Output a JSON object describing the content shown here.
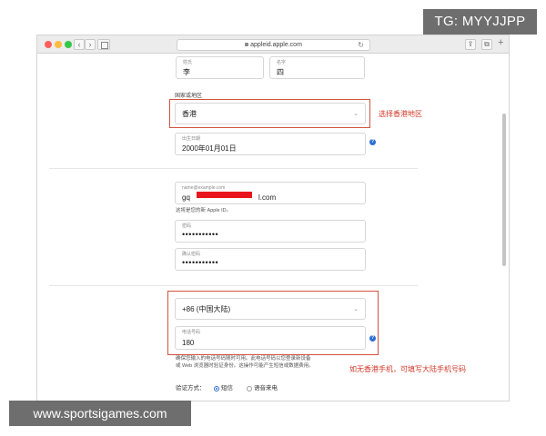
{
  "browser": {
    "url": "appleid.apple.com",
    "nav_back": "‹",
    "nav_forward": "›",
    "reload": "↻",
    "share": "⇪",
    "tabs": "⧉",
    "new_tab": "+"
  },
  "form": {
    "last_name_label": "姓氏",
    "last_name_value": "李",
    "first_name_label": "名字",
    "first_name_value": "四",
    "region_label": "国家或地区",
    "region_value": "香港",
    "birthdate_label": "出生日期",
    "birthdate_value": "2000年01月01日",
    "email_label": "name@example.com",
    "email_prefix": "gq",
    "email_suffix": "l.com",
    "email_hint": "这将是您的新 Apple ID。",
    "password_label": "密码",
    "password_value": "•••••••••••",
    "confirm_label": "确认密码",
    "confirm_value": "•••••••••••",
    "phone_code_value": "+86 (中国大陆)",
    "phone_label": "电话号码",
    "phone_value": "180",
    "phone_hint_line1": "确保您输入的电话号码随时可用。此电话号码以您登录新设备",
    "phone_hint_line2": "或 Web 浏览器时验证身份。这操作可能产生短信或数据费用。",
    "verify_label": "验证方式：",
    "verify_options": [
      {
        "label": "短信",
        "selected": true
      },
      {
        "label": "语音来电",
        "selected": false
      }
    ]
  },
  "icons": {
    "dropdown": "⌄",
    "help": "?"
  },
  "annotations": {
    "region_note": "选择香港地区",
    "phone_note": "如无香港手机，可填写大陆手机号码",
    "color": "#d2523f"
  },
  "watermarks": {
    "top": "TG: MYYJJPP",
    "bottom": "www.sportsigames.com"
  }
}
